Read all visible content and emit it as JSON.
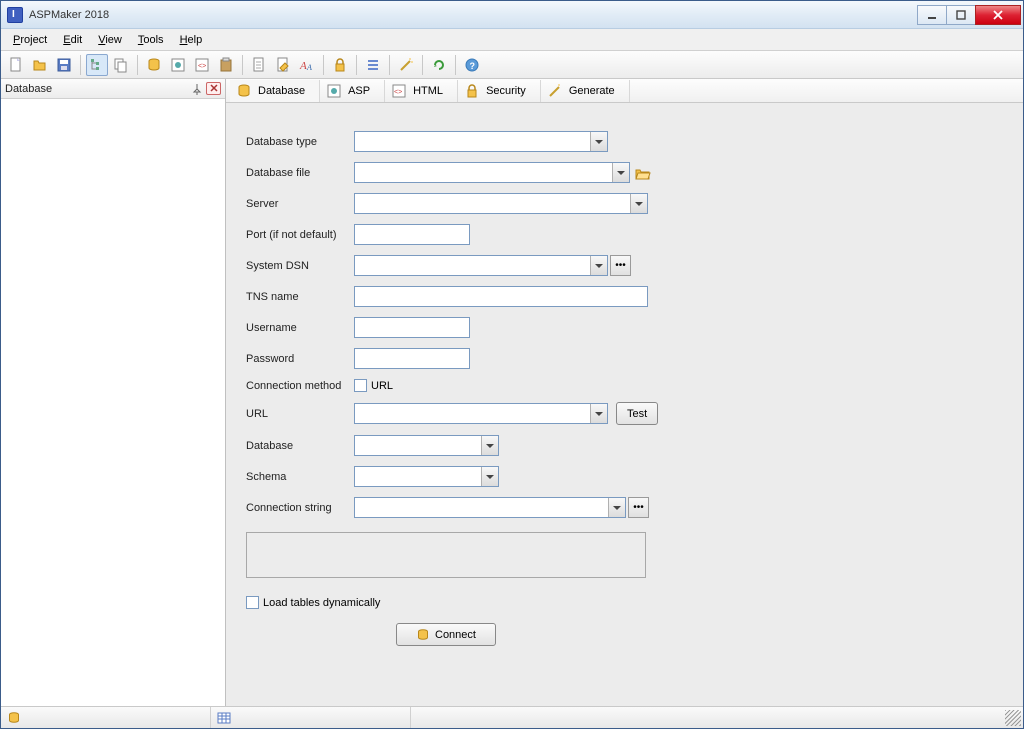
{
  "titlebar": {
    "title": "ASPMaker 2018"
  },
  "menu": {
    "project": "Project",
    "edit": "Edit",
    "view": "View",
    "tools": "Tools",
    "help": "Help"
  },
  "left_panel": {
    "title": "Database"
  },
  "tabs": [
    {
      "label": "Database"
    },
    {
      "label": "ASP"
    },
    {
      "label": "HTML"
    },
    {
      "label": "Security"
    },
    {
      "label": "Generate"
    }
  ],
  "form": {
    "labels": {
      "db_type": "Database type",
      "db_file": "Database file",
      "server": "Server",
      "port": "Port (if not default)",
      "system_dsn": "System DSN",
      "tns_name": "TNS name",
      "username": "Username",
      "password": "Password",
      "conn_method": "Connection method",
      "url_cb": "URL",
      "url": "URL",
      "database": "Database",
      "schema": "Schema",
      "conn_string": "Connection string",
      "load_dyn": "Load tables dynamically"
    },
    "values": {
      "db_type": "",
      "db_file": "",
      "server": "",
      "port": "",
      "system_dsn": "",
      "tns_name": "",
      "username": "",
      "password": "",
      "url": "",
      "database": "",
      "schema": "",
      "conn_string": ""
    },
    "buttons": {
      "test": "Test",
      "connect": "Connect"
    }
  }
}
